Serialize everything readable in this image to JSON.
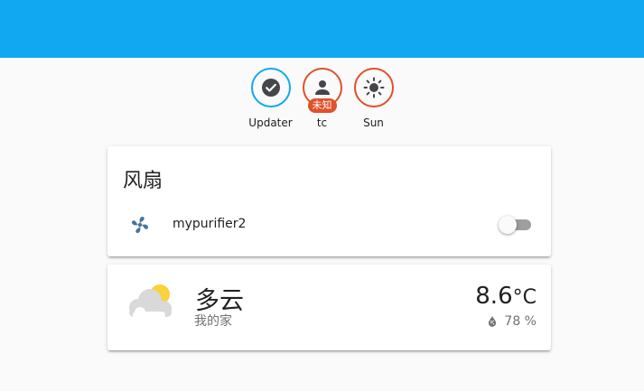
{
  "colors": {
    "header": "#12a7f1",
    "badge_ok": "#12a7f1",
    "badge_alert": "#e0502a"
  },
  "badges": [
    {
      "label": "Updater",
      "icon": "check-circle-icon"
    },
    {
      "label": "tc",
      "icon": "person-icon",
      "tag": "未知"
    },
    {
      "label": "Sun",
      "icon": "sun-icon"
    }
  ],
  "entities_card": {
    "title": "风扇",
    "rows": [
      {
        "name": "mypurifier2",
        "icon": "fan-icon",
        "state": "off"
      }
    ]
  },
  "weather_card": {
    "state": "多云",
    "name": "我的家",
    "temperature": "8.6",
    "unit": "°C",
    "humidity": "78 %",
    "icon": "partly-cloudy-icon"
  }
}
